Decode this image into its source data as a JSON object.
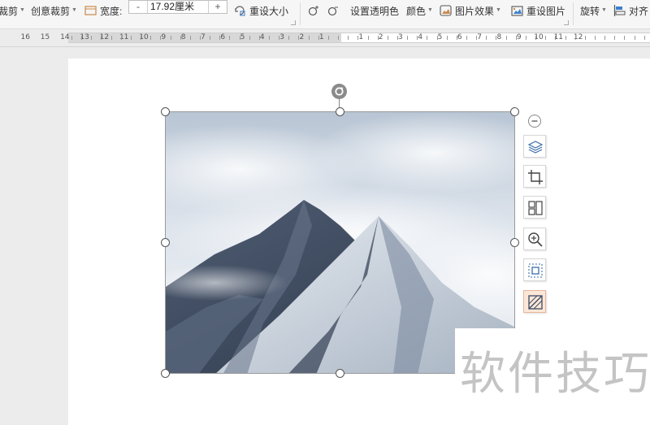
{
  "toolbar": {
    "crop_label": "裁剪",
    "creative_crop_label": "创意裁剪",
    "width_label": "宽度:",
    "width_minus": "-",
    "width_value": "17.92厘米",
    "width_plus": "+",
    "reset_size_label": "重设大小",
    "set_transparent_label": "设置透明色",
    "color_label": "颜色",
    "picture_effects_label": "图片效果",
    "reset_picture_label": "重设图片",
    "rotate_label": "旋转",
    "align_label": "对齐"
  },
  "ruler": {
    "left_numbers": [
      "16",
      "15",
      "14",
      "13",
      "12",
      "11",
      "10",
      "9",
      "8",
      "7",
      "6",
      "5",
      "4",
      "3",
      "2",
      "1"
    ],
    "right_numbers": [
      "1",
      "2",
      "3",
      "4",
      "5",
      "6",
      "7",
      "8",
      "9",
      "10",
      "11",
      "12"
    ]
  },
  "side_toolbar": {
    "icons": [
      "layout-options-icon",
      "crop-icon",
      "picture-layout-icon",
      "zoom-in-icon",
      "extract-icon",
      "picture-style-icon"
    ]
  },
  "watermark": {
    "text": "软件技巧"
  },
  "colors": {
    "toolbar_bg": "#f6f6f6",
    "page_bg": "#ffffff",
    "workspace_bg": "#ececec",
    "watermark": "#c4c4c4",
    "active_side_button": "#fbe7d8"
  }
}
